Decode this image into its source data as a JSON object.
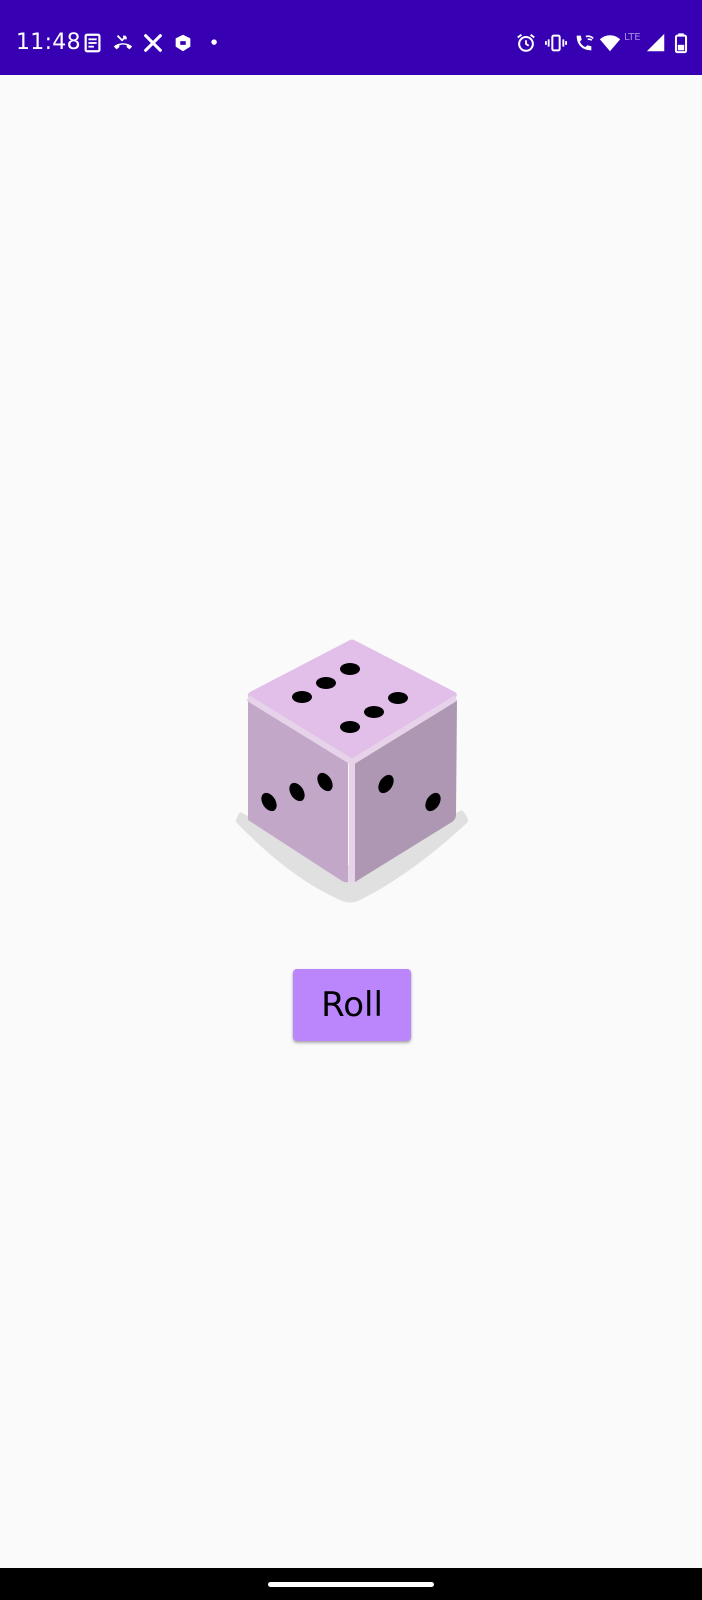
{
  "status_bar": {
    "time": "11:48",
    "network_label": "LTE",
    "background_color": "#3700b3",
    "left_icons": [
      "news-icon",
      "missed-call-icon",
      "tools-icon",
      "app-notification-icon",
      "dot-icon"
    ],
    "right_icons": [
      "alarm-icon",
      "vibrate-icon",
      "wifi-calling-icon",
      "wifi-icon",
      "signal-icon",
      "battery-icon"
    ]
  },
  "main": {
    "die": {
      "face_value": 6,
      "top_color": "#e1bfe9",
      "left_color": "#c3a7c9",
      "right_color": "#ad97b2",
      "pip_color": "#000000"
    },
    "roll_button": {
      "label": "Roll",
      "color": "#bb86fc"
    }
  },
  "nav_bar": {
    "background_color": "#000000"
  }
}
